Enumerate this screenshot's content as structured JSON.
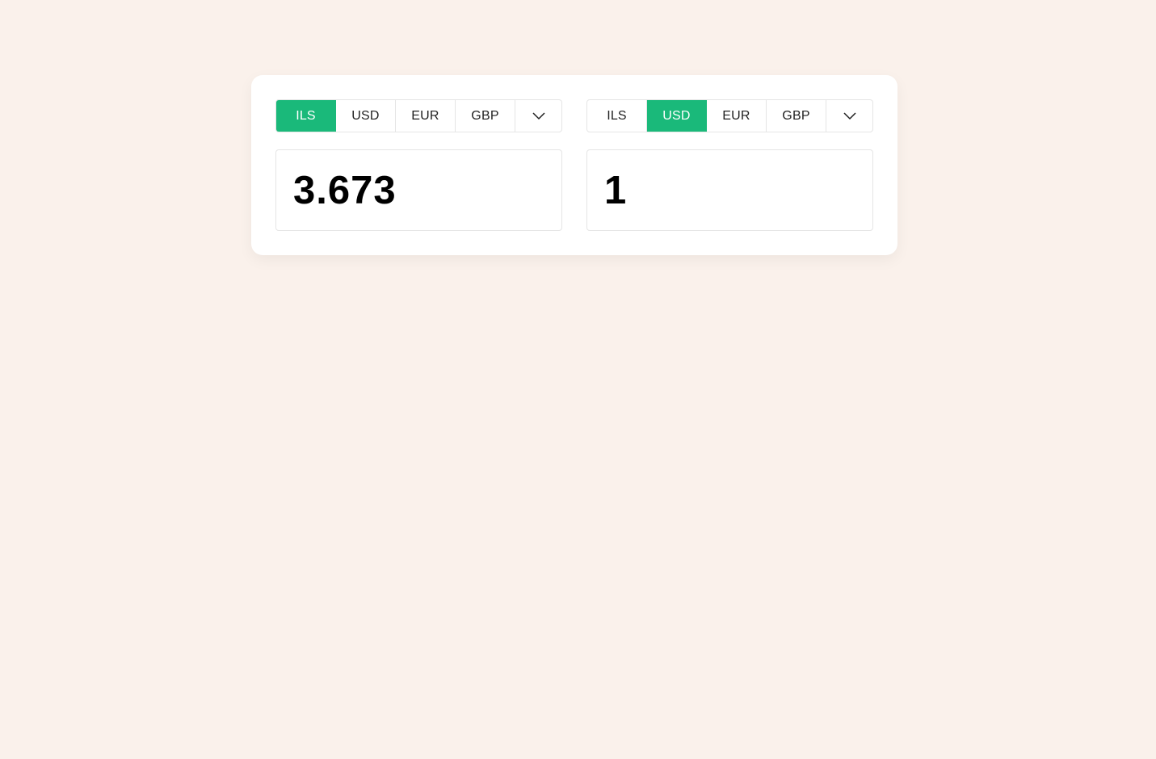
{
  "colors": {
    "background": "#faf1eb",
    "card": "#ffffff",
    "accent": "#1ab97a"
  },
  "converter": {
    "from": {
      "tabs": [
        {
          "label": "ILS",
          "active": true
        },
        {
          "label": "USD",
          "active": false
        },
        {
          "label": "EUR",
          "active": false
        },
        {
          "label": "GBP",
          "active": false
        }
      ],
      "more_icon": "chevron-down-icon",
      "value": "3.673"
    },
    "to": {
      "tabs": [
        {
          "label": "ILS",
          "active": false
        },
        {
          "label": "USD",
          "active": true
        },
        {
          "label": "EUR",
          "active": false
        },
        {
          "label": "GBP",
          "active": false
        }
      ],
      "more_icon": "chevron-down-icon",
      "value": "1"
    }
  }
}
